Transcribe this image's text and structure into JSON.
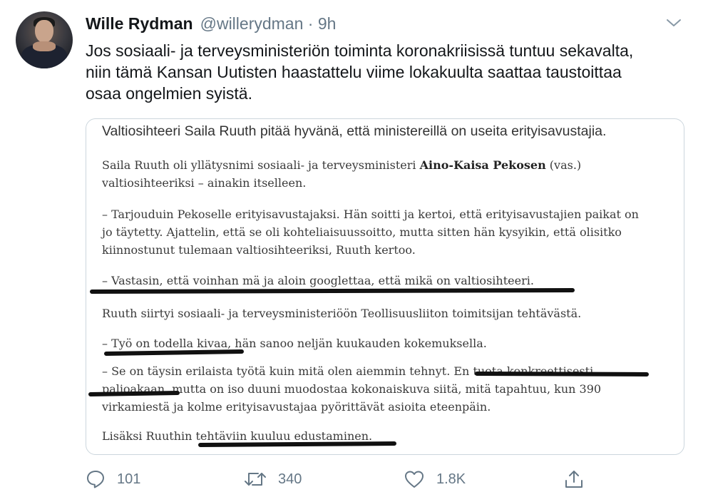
{
  "author": {
    "name": "Wille Rydman",
    "handle": "@willerydman",
    "separator": "·",
    "time": "9h"
  },
  "tweet": {
    "lines": [
      "Jos sosiaali- ja terveysministeriön toiminta koronakriisissä tuntuu sekavalta,",
      "niin tämä Kansan Uutisten haastattelu viime lokakuulta saattaa taustoittaa",
      "osaa ongelmien syistä."
    ]
  },
  "article": {
    "lead": "Valtiosihteeri Saila Ruuth pitää hyvänä, että ministereillä on useita erityisavustajia.",
    "p1": {
      "line1_a": "Saila Ruuth oli yllätysnimi sosiaali- ja terveysministeri ",
      "line1_bold": "Aino-Kaisa Pekosen",
      "line1_b": " (vas.)",
      "line2": "valtiosihteeriksi – ainakin itselleen."
    },
    "p2": [
      "– Tarjouduin Pekoselle erityisavustajaksi. Hän soitti ja kertoi, että erityisavustajien paikat on",
      "jo täytetty. Ajattelin, että se oli kohteliaisuussoitto, mutta sitten hän kysyikin, että olisitko",
      "kiinnostunut tulemaan valtiosihteeriksi, Ruuth kertoo."
    ],
    "p3": "– Vastasin, että voinhan mä ja aloin googlettaa, että mikä on valtiosihteeri.",
    "p4": "Ruuth siirtyi sosiaali- ja terveysministeriöön Teollisuusliiton toimitsijan tehtävästä.",
    "p5": "– Työ on todella kivaa, hän sanoo neljän kuukauden kokemuksella.",
    "p6": [
      "– Se on täysin erilaista työtä kuin mitä olen aiemmin tehnyt. En tuota konkreettisesti",
      "paljoakaan, mutta on iso duuni muodostaa kokonaiskuva siitä, mitä tapahtuu, kun 390",
      "virkamiestä ja kolme erityisavustajaa pyörittävät asioita eteenpäin."
    ],
    "p7": "Lisäksi Ruuthin tehtäviin kuuluu edustaminen."
  },
  "actions": {
    "reply": {
      "icon": "reply-icon",
      "count": "101"
    },
    "retweet": {
      "icon": "retweet-icon",
      "count": "340"
    },
    "like": {
      "icon": "heart-icon",
      "count": "1.8K"
    },
    "share": {
      "icon": "share-icon"
    }
  },
  "colors": {
    "text": "#14171a",
    "secondary": "#657786",
    "border": "#ccd6dd",
    "ink": "#111111"
  }
}
